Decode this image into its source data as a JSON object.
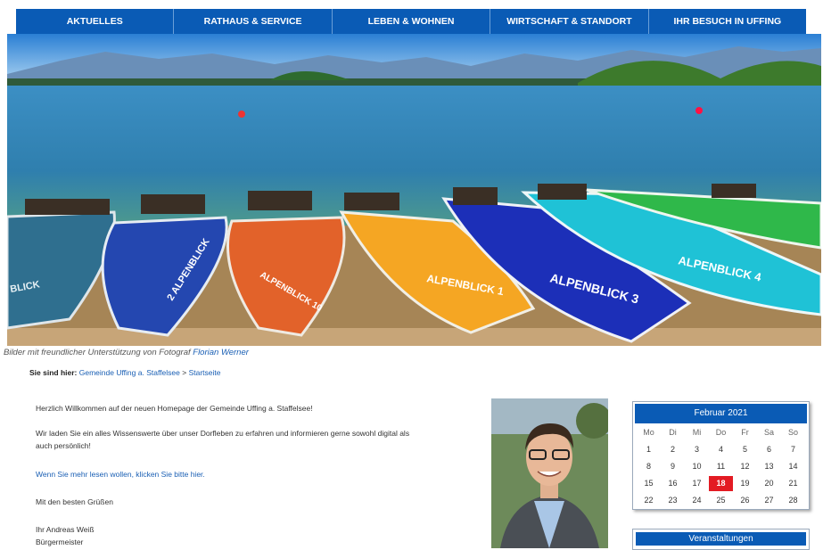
{
  "nav": {
    "items": [
      {
        "label": "AKTUELLES"
      },
      {
        "label": "RATHAUS & SERVICE"
      },
      {
        "label": "LEBEN & WOHNEN"
      },
      {
        "label": "WIRTSCHAFT & STANDORT"
      },
      {
        "label": "IHR BESUCH IN UFFING"
      }
    ]
  },
  "hero": {
    "boats": [
      {
        "label": "BLICK",
        "color": "#2f6f8f"
      },
      {
        "label": "2 ALPENBLICK",
        "color": "#2447b0"
      },
      {
        "label": "ALPENBLICK 10",
        "color": "#e2622a"
      },
      {
        "label": "ALPENBLICK 1",
        "color": "#f5a623"
      },
      {
        "label": "ALPENBLICK 3",
        "color": "#1c2fb8"
      },
      {
        "label": "ALPENBLICK 4",
        "color": "#1fc2d6"
      },
      {
        "label": "",
        "color": "#2fb84a"
      }
    ]
  },
  "caption": {
    "text": "Bilder mit freundlicher Unterstützung von Fotograf ",
    "link": "Florian Werner"
  },
  "breadcrumb": {
    "label": "Sie sind hier:",
    "home": "Gemeinde Uffing a. Staffelsee",
    "separator": ">",
    "current": "Startseite"
  },
  "welcome": {
    "line1": "Herzlich Willkommen auf der neuen Homepage der Gemeinde Uffing a. Staffelsee!",
    "line2a": "Wir laden Sie ein alles Wissenswerte über unser Dorfleben zu erfahren und informieren gerne sowohl digital als",
    "line2b": "auch persönlich!",
    "link": "Wenn Sie mehr lesen wollen, klicken Sie bitte hier.",
    "greeting": "Mit den besten Grüßen",
    "name": "Ihr Andreas Weiß",
    "role": "Bürgermeister"
  },
  "calendar": {
    "title": "Februar 2021",
    "weekdays": [
      "Mo",
      "Di",
      "Mi",
      "Do",
      "Fr",
      "Sa",
      "So"
    ],
    "days": [
      "1",
      "2",
      "3",
      "4",
      "5",
      "6",
      "7",
      "8",
      "9",
      "10",
      "11",
      "12",
      "13",
      "14",
      "15",
      "16",
      "17",
      "18",
      "19",
      "20",
      "21",
      "22",
      "23",
      "24",
      "25",
      "26",
      "27",
      "28"
    ],
    "today": "18",
    "accent": "#e31b23"
  },
  "events": {
    "title": "Veranstaltungen"
  },
  "colors": {
    "primary": "#0a5bb5",
    "link": "#1a5fb4"
  }
}
